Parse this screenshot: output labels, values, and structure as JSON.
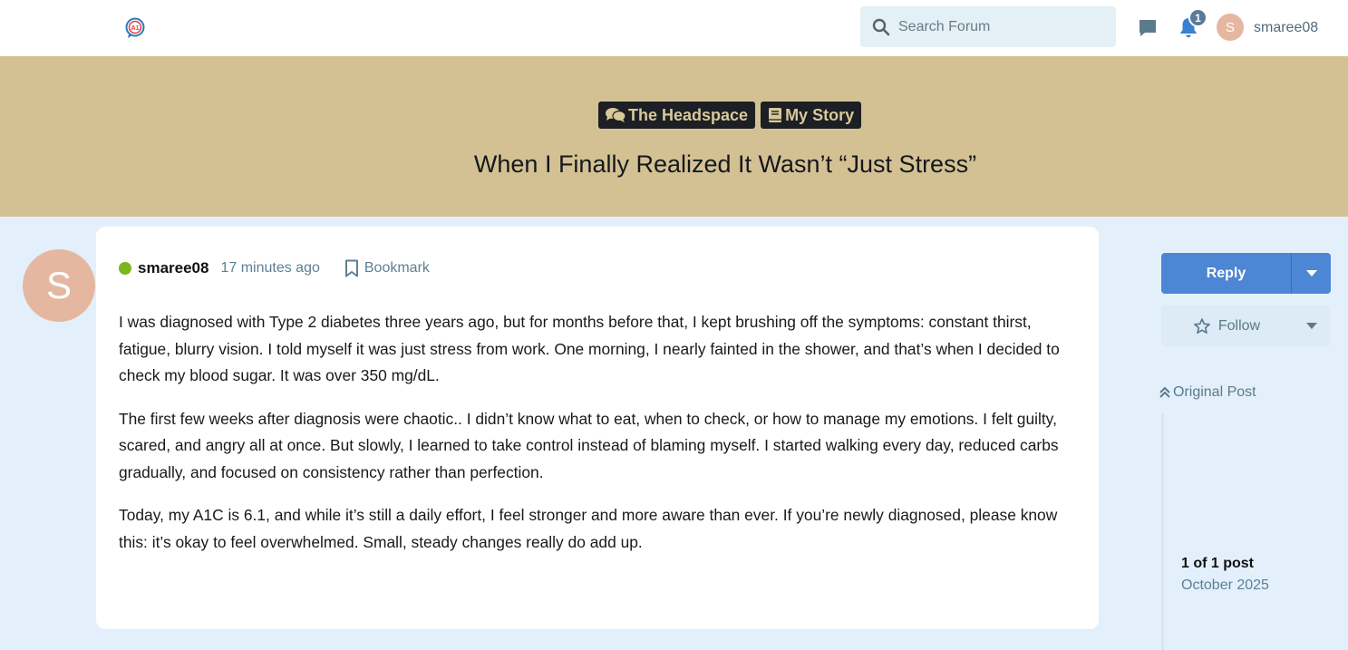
{
  "header": {
    "logo_icon": "a1-chat-logo-icon",
    "search_placeholder": "Search Forum",
    "notification_count": "1",
    "user_initial": "S",
    "username": "smaree08"
  },
  "topic": {
    "categories": [
      {
        "label": "The Headspace",
        "icon": "comments-icon"
      },
      {
        "label": "My Story",
        "icon": "book-icon"
      }
    ],
    "title": "When I Finally Realized It Wasn’t “Just Stress”"
  },
  "post": {
    "avatar_initial": "S",
    "author": "smaree08",
    "time": "17 minutes ago",
    "bookmark_label": "Bookmark",
    "paragraphs": [
      "I was diagnosed with Type 2 diabetes three years ago, but for months before that, I kept brushing off the symptoms: constant thirst, fatigue, blurry vision. I told myself it was just stress from work. One morning, I nearly fainted in the shower, and that’s when I decided to check my blood sugar. It was over 350 mg/dL.",
      "The first few weeks after diagnosis were chaotic.. I didn’t know what to eat, when to check, or how to manage my emotions. I felt guilty, scared, and angry all at once. But slowly, I learned to take control instead of blaming myself. I started walking every day, reduced carbs gradually, and focused on consistency rather than perfection.",
      "Today, my A1C is 6.1, and while it’s still a daily effort, I feel stronger and more aware than ever. If you’re newly diagnosed, please know this: it’s okay to feel overwhelmed. Small, steady changes really do add up."
    ]
  },
  "sidebar": {
    "reply_label": "Reply",
    "follow_label": "Follow",
    "original_post_label": "Original Post",
    "post_count": "1 of 1 post",
    "date": "October 2025"
  },
  "colors": {
    "hero_bg": "#d4c193",
    "page_bg": "#e3f0fb",
    "accent": "#4d86d4",
    "online": "#7db51e"
  }
}
